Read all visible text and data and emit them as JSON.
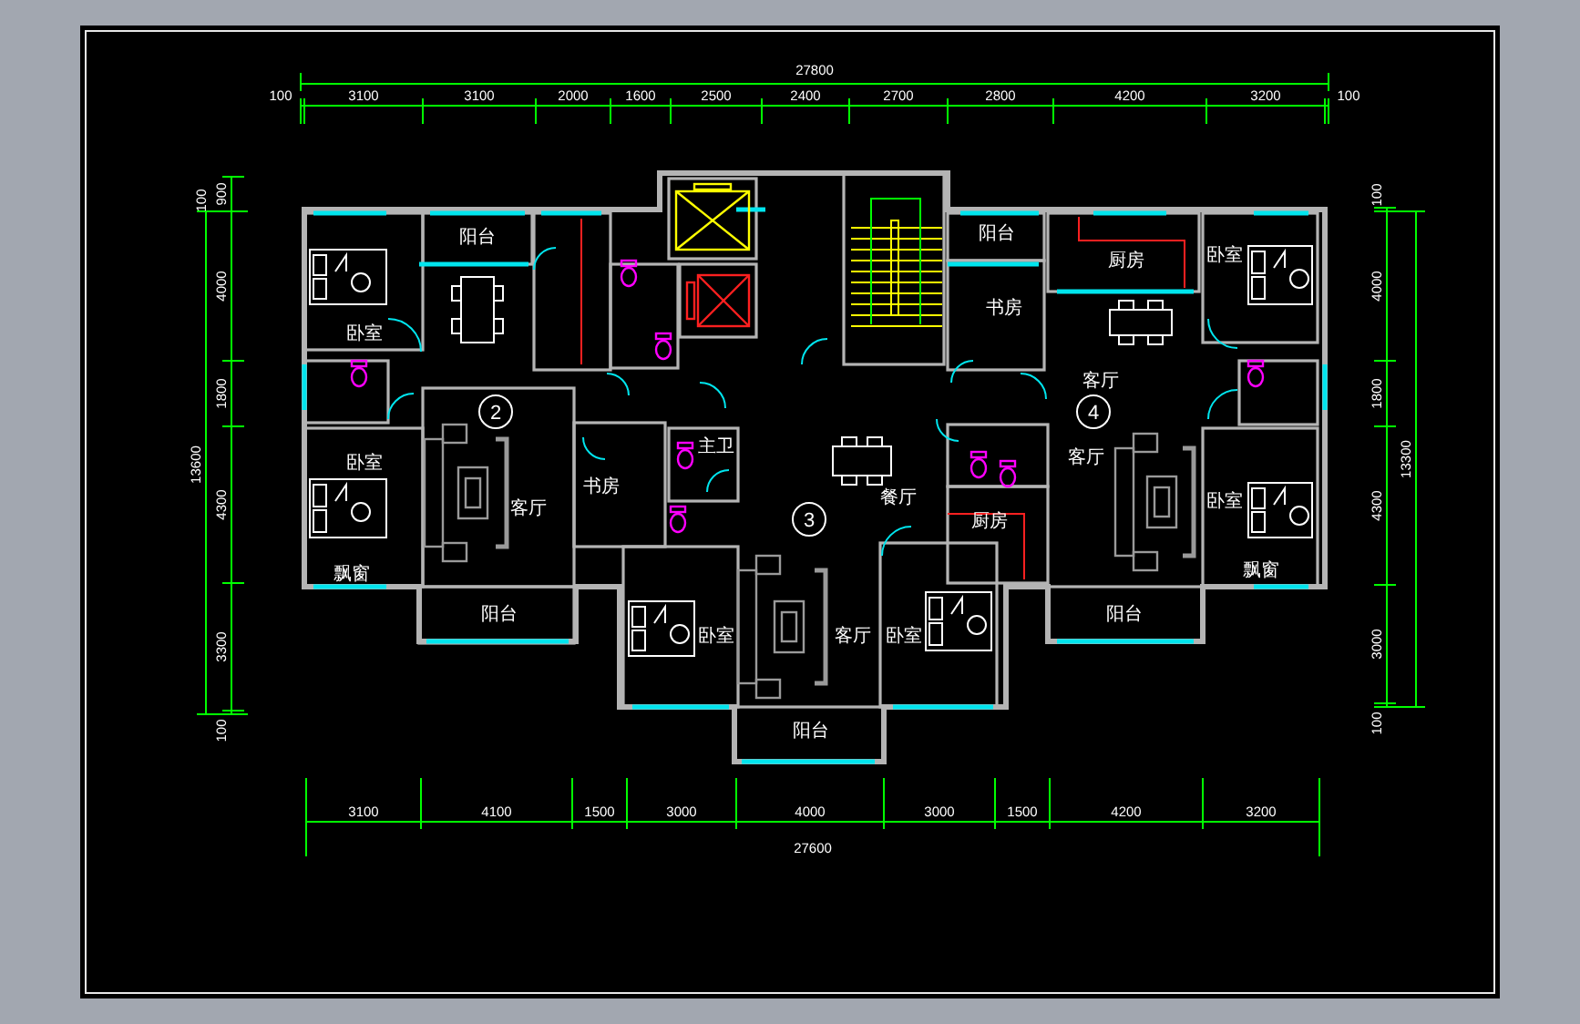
{
  "dimensions": {
    "top": {
      "total": "27800",
      "segments": [
        "100",
        "3100",
        "3100",
        "2000",
        "1600",
        "2500",
        "2400",
        "2700",
        "2800",
        "4200",
        "3200",
        "100"
      ]
    },
    "bottom": {
      "total": "27600",
      "segments": [
        "3100",
        "4100",
        "1500",
        "3000",
        "4000",
        "3000",
        "1500",
        "4200",
        "3200"
      ]
    },
    "left": {
      "total": "13600",
      "segments": [
        "100",
        "900",
        "4000",
        "1800",
        "4300",
        "3300",
        "100"
      ]
    },
    "right": {
      "total": "13300",
      "segments": [
        "100",
        "4000",
        "1800",
        "4300",
        "3000",
        "100"
      ]
    }
  },
  "units": [
    {
      "number": "2"
    },
    {
      "number": "3"
    },
    {
      "number": "4"
    }
  ],
  "rooms": [
    {
      "label": "阳台"
    },
    {
      "label": "卧室"
    },
    {
      "label": "卧室"
    },
    {
      "label": "客厅"
    },
    {
      "label": "阳台"
    },
    {
      "label": "飘窗"
    },
    {
      "label": "书房"
    },
    {
      "label": "主卫"
    },
    {
      "label": "卧室"
    },
    {
      "label": "客厅"
    },
    {
      "label": "阳台"
    },
    {
      "label": "餐厅"
    },
    {
      "label": "厨房"
    },
    {
      "label": "卧室"
    },
    {
      "label": "阳台"
    },
    {
      "label": "书房"
    },
    {
      "label": "厨房"
    },
    {
      "label": "客厅"
    },
    {
      "label": "客厅"
    },
    {
      "label": "卧室"
    },
    {
      "label": "卧室"
    },
    {
      "label": "阳台"
    },
    {
      "label": "飘窗"
    }
  ]
}
